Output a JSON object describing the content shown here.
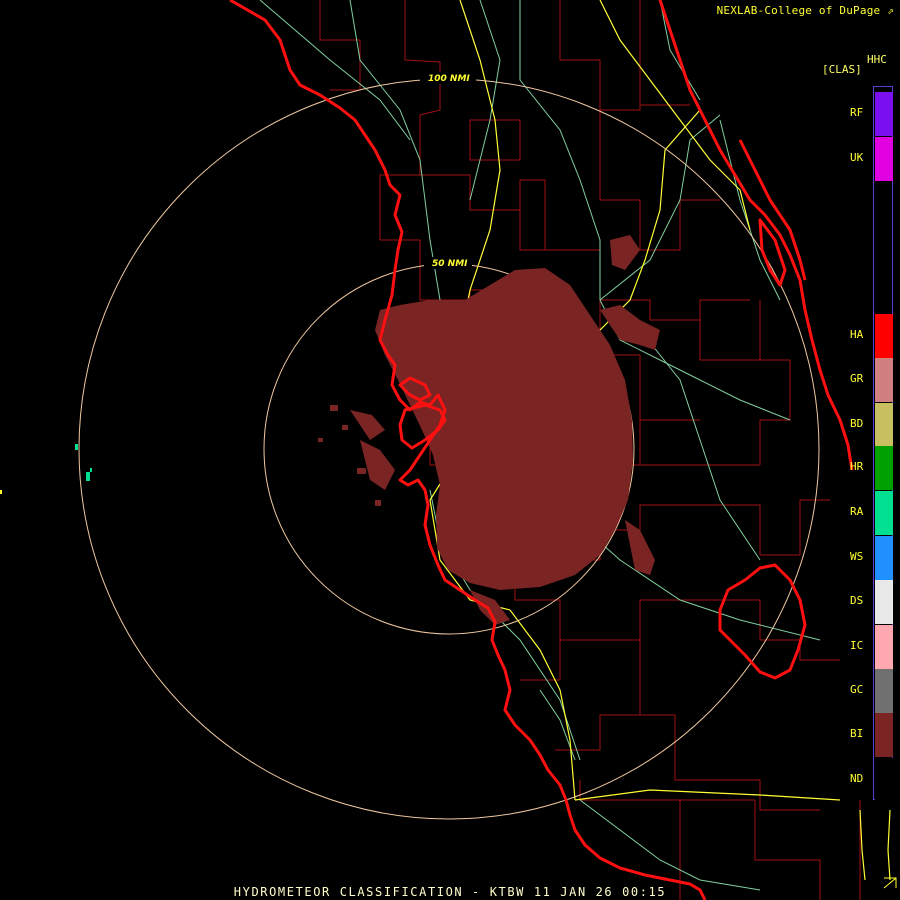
{
  "credit": "NEXLAB-College of DuPage",
  "product": {
    "code": "HHC",
    "subtitle": "[CLAS]"
  },
  "caption": "HYDROMETEOR CLASSIFICATION - KTBW 11 JAN 26 00:15",
  "range_rings": [
    {
      "label": "100 NMI"
    },
    {
      "label": "50 NMI"
    }
  ],
  "legend": [
    {
      "code": "RF",
      "color": "#7a0ff0"
    },
    {
      "code": "UK",
      "color": "#e000e0"
    },
    {
      "code": "HA",
      "color": "#ff0000"
    },
    {
      "code": "GR",
      "color": "#d08080"
    },
    {
      "code": "BD",
      "color": "#c8c060"
    },
    {
      "code": "HR",
      "color": "#00a000"
    },
    {
      "code": "RA",
      "color": "#00e090"
    },
    {
      "code": "WS",
      "color": "#2090ff"
    },
    {
      "code": "DS",
      "color": "#e8e8e8"
    },
    {
      "code": "IC",
      "color": "#ffa8b0"
    },
    {
      "code": "GC",
      "color": "#707070"
    },
    {
      "code": "BI",
      "color": "#7a2424"
    },
    {
      "code": "ND",
      "color": "#000000"
    }
  ],
  "colors": {
    "coastline": "#ff1010",
    "county_lines": "#a01010",
    "highways": "#ffff33",
    "roads": "#80d0a0",
    "range_rings": "#f0c8a0",
    "echo": "#7a2424"
  }
}
